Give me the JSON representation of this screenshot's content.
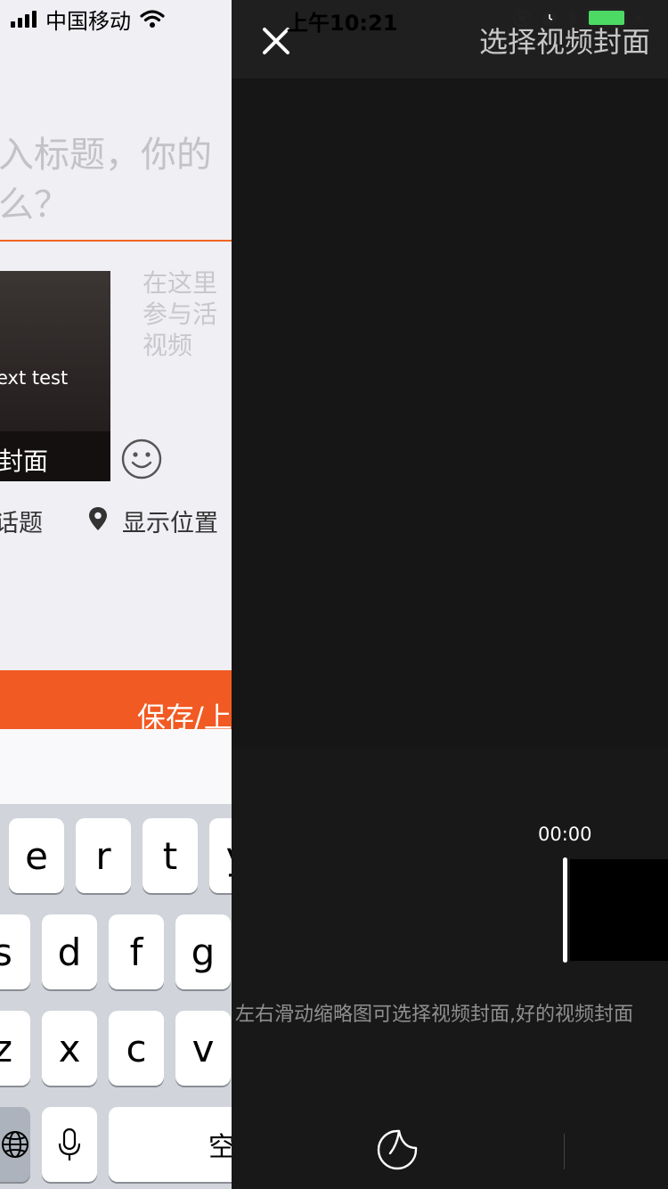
{
  "status_bar": {
    "carrier": "中国移动",
    "time": "上午10:21"
  },
  "compose": {
    "title_placeholder": "入标题，你的\n么？",
    "thumbnail_caption": "ext test",
    "thumbnail_cover_label": "封面",
    "description_placeholder": "在这里\n参与活\n视频",
    "topic_label": "话题",
    "location_label": "显示位置",
    "save_button_label": "保存/上",
    "accent_color": "#f15a22"
  },
  "keyboard": {
    "row1": [
      "e",
      "r",
      "t",
      "y"
    ],
    "row2": [
      "s",
      "d",
      "f",
      "g"
    ],
    "row3": [
      "z",
      "x",
      "c",
      "v"
    ],
    "space_label": "空"
  },
  "cover_picker": {
    "title": "选择视频封面",
    "timecode": "00:00",
    "hint": "左右滑动缩略图可选择视频封面,好的视频封面"
  },
  "icons": {
    "close": "close-icon",
    "smile": "emoji-icon",
    "pin": "location-pin-icon",
    "sticker": "sticker-icon",
    "globe": "globe-icon",
    "mic": "microphone-icon"
  }
}
